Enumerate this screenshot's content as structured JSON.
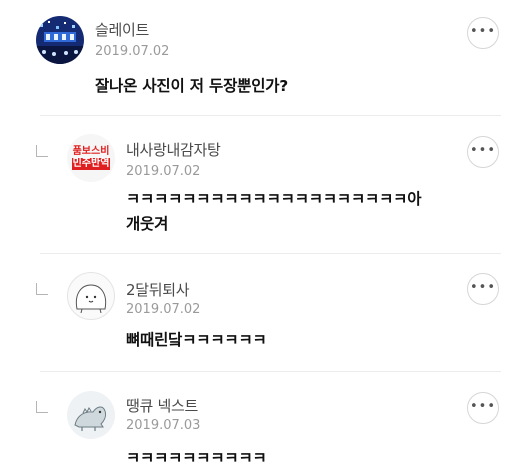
{
  "comments": [
    {
      "name": "슬레이트",
      "date": "2019.07.02",
      "text": "잘나온 사진이 저 두장뿐인가?",
      "avatar": "concert-crowd-photo"
    },
    {
      "name": "내사랑내감자탕",
      "date": "2019.07.02",
      "text_line1": "ㅋㅋㅋㅋㅋㅋㅋㅋㅋㅋㅋㅋㅋㅋㅋㅋㅋㅋㅋㅋ아",
      "text_line2": "개웃겨",
      "avatar_text_line1": "품보스비",
      "avatar_text_line2": "민주반역"
    },
    {
      "name": "2달뒤퇴사",
      "date": "2019.07.02",
      "text": "뼈때린닼ㅋㅋㅋㅋㅋㅋ",
      "avatar": "cute-blob-drawing"
    },
    {
      "name": "땡큐 넥스트",
      "date": "2019.07.03",
      "text": "ㅋㅋㅋㅋㅋㅋㅋㅋㅋㅋ",
      "avatar": "dinosaur-drawing"
    }
  ],
  "more_label": "•••"
}
